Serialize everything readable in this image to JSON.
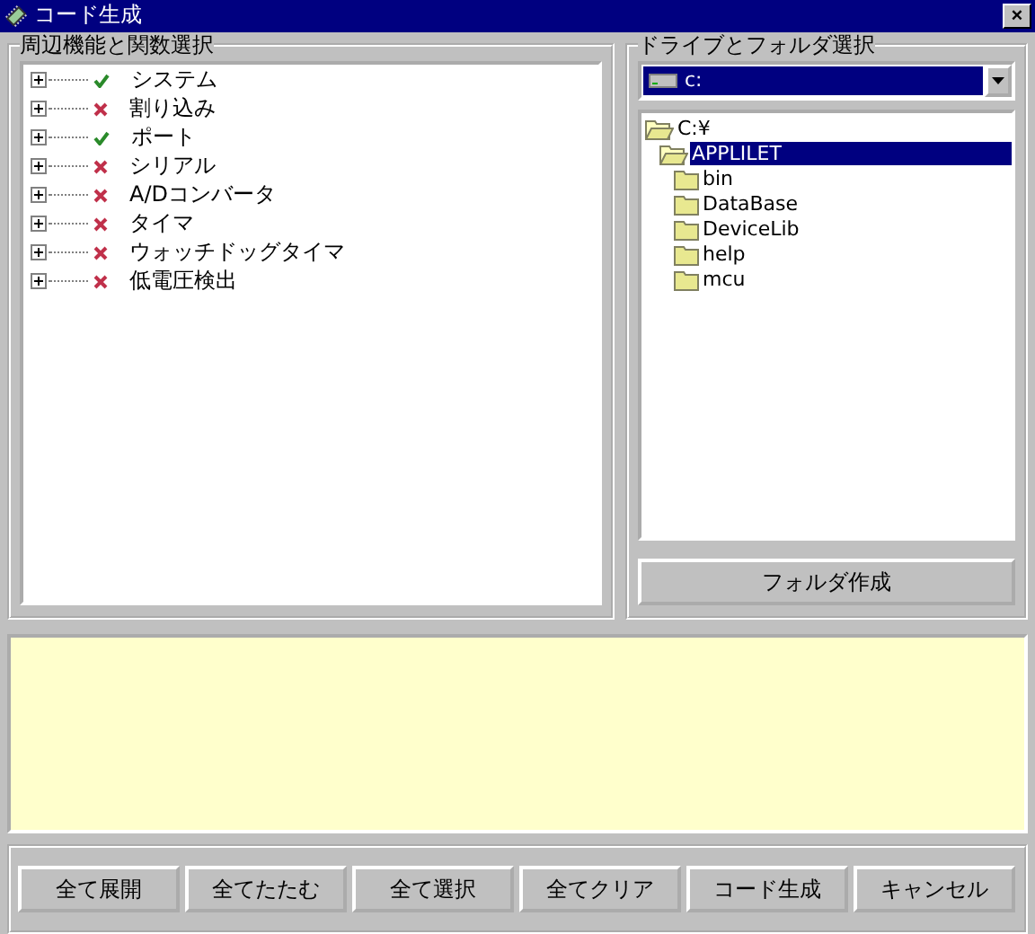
{
  "window": {
    "title": "コード生成",
    "close": "×"
  },
  "functions": {
    "title": "周辺機能と関数選択",
    "items": [
      {
        "label": "システム",
        "checked": true,
        "expanded": false
      },
      {
        "label": "割り込み",
        "checked": false,
        "expanded": false
      },
      {
        "label": "ポート",
        "checked": true,
        "expanded": false
      },
      {
        "label": "シリアル",
        "checked": false,
        "expanded": false
      },
      {
        "label": "A/Dコンバータ",
        "checked": false,
        "expanded": false
      },
      {
        "label": "タイマ",
        "checked": false,
        "expanded": false
      },
      {
        "label": "ウォッチドッグタイマ",
        "checked": false,
        "expanded": false
      },
      {
        "label": "低電圧検出",
        "checked": false,
        "expanded": false
      }
    ]
  },
  "folders": {
    "title": "ドライブとフォルダ選択",
    "drive": "c:",
    "tree": [
      {
        "label": "C:¥",
        "expanded": true,
        "selected": false,
        "children": [
          {
            "label": "APPLILET",
            "expanded": true,
            "selected": true,
            "children": [
              {
                "label": "bin",
                "expanded": false,
                "selected": false
              },
              {
                "label": "DataBase",
                "expanded": false,
                "selected": false
              },
              {
                "label": "DeviceLib",
                "expanded": false,
                "selected": false
              },
              {
                "label": "help",
                "expanded": false,
                "selected": false
              },
              {
                "label": "mcu",
                "expanded": false,
                "selected": false
              }
            ]
          }
        ]
      }
    ],
    "create_button": "フォルダ作成"
  },
  "buttons": [
    "全て展開",
    "全てたたむ",
    "全て選択",
    "全てクリア",
    "コード生成",
    "キャンセル"
  ]
}
